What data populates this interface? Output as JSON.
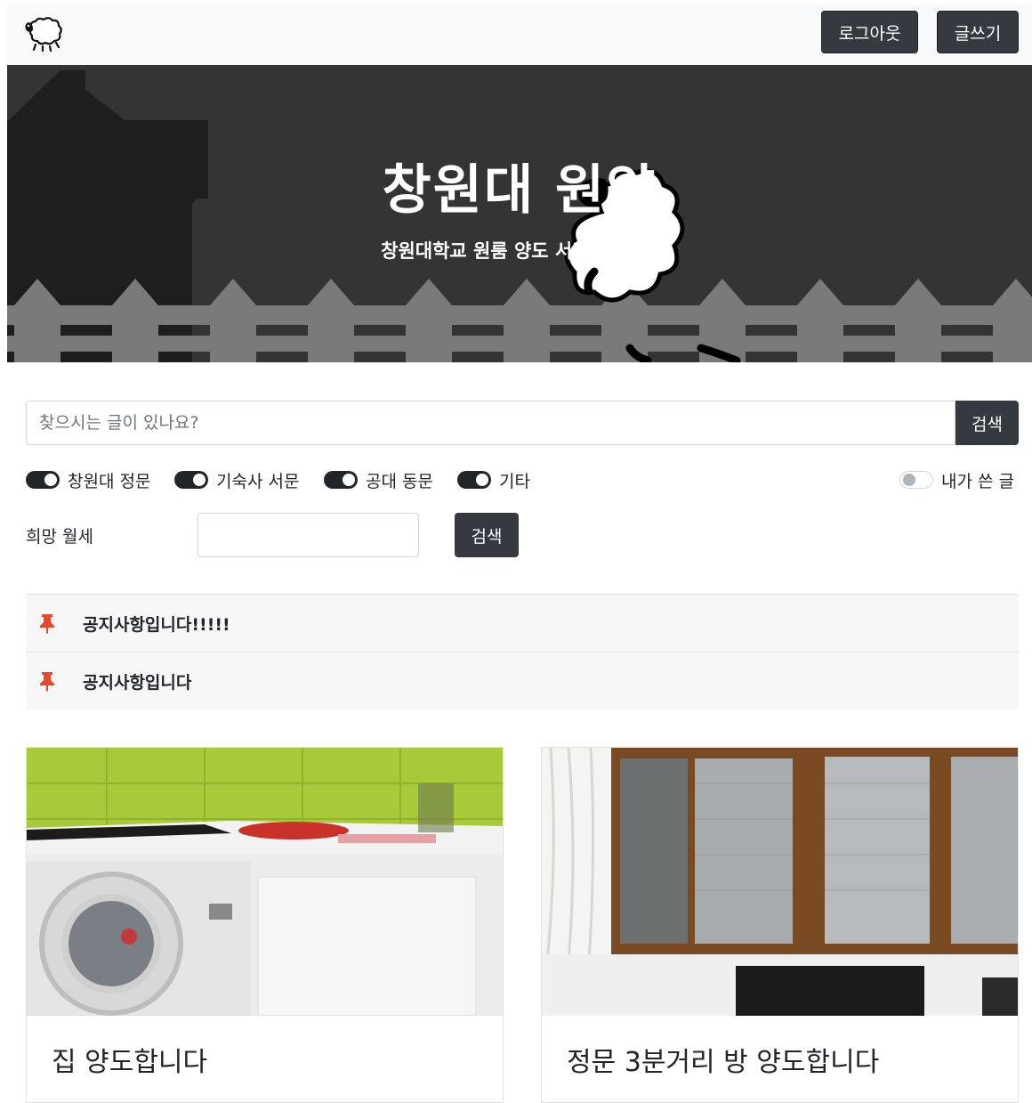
{
  "navbar": {
    "logo_icon": "sheep-icon",
    "logout_label": "로그아웃",
    "write_label": "글쓰기"
  },
  "hero": {
    "title": "창원대 원양",
    "subtitle": "창원대학교 원룸 양도 서비스입니다"
  },
  "search": {
    "placeholder": "찾으시는 글이 있나요?",
    "button_label": "검색"
  },
  "filters": {
    "items": [
      {
        "label": "창원대 정문",
        "checked": true
      },
      {
        "label": "기숙사 서문",
        "checked": true
      },
      {
        "label": "공대 동문",
        "checked": true
      },
      {
        "label": "기타",
        "checked": true
      }
    ],
    "my_posts": {
      "label": "내가 쓴 글",
      "checked": false
    }
  },
  "rent": {
    "label": "희망 월세",
    "value": "",
    "button_label": "검색"
  },
  "notices": [
    {
      "title": "공지사항입니다!!!!!",
      "icon": "pin-icon"
    },
    {
      "title": "공지사항입니다",
      "icon": "pin-icon"
    }
  ],
  "posts": [
    {
      "title": "집 양도합니다"
    },
    {
      "title": "정문 3분거리 방 양도합니다"
    }
  ],
  "colors": {
    "dark": "#343a40",
    "hero_bg": "#343434",
    "pin": "#e8472b"
  }
}
